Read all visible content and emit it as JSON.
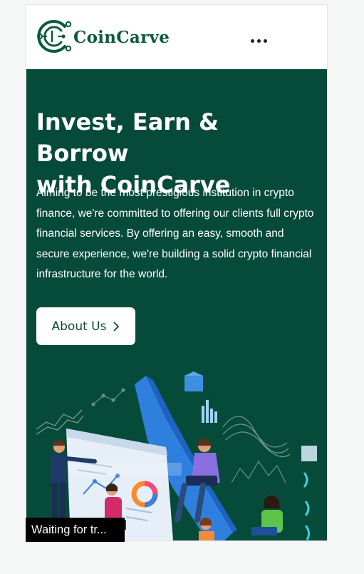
{
  "header": {
    "brand_name": "CoinCarve",
    "logo_icon": "coincarve-circuit-c-icon",
    "menu_icon": "more-horizontal-icon"
  },
  "hero": {
    "title_line1": "Invest, Earn & Borrow",
    "title_line2": "with CoinCarve",
    "description": "Aiming to be the most prestigious institution in crypto finance, we're committed to offering our clients full crypto financial services. By offering an easy, smooth and secure experience, we're building a solid crypto financial infrastructure for the world.",
    "cta_label": "About Us",
    "cta_icon": "chevron-right-icon",
    "illustration": "crypto-analytics-team-illustration"
  },
  "status": {
    "toast_text": "Waiting for tr..."
  },
  "colors": {
    "brand_green": "#0b5a3f",
    "hero_background": "#064b39",
    "button_background": "#ffffff",
    "toast_background": "#000000"
  }
}
